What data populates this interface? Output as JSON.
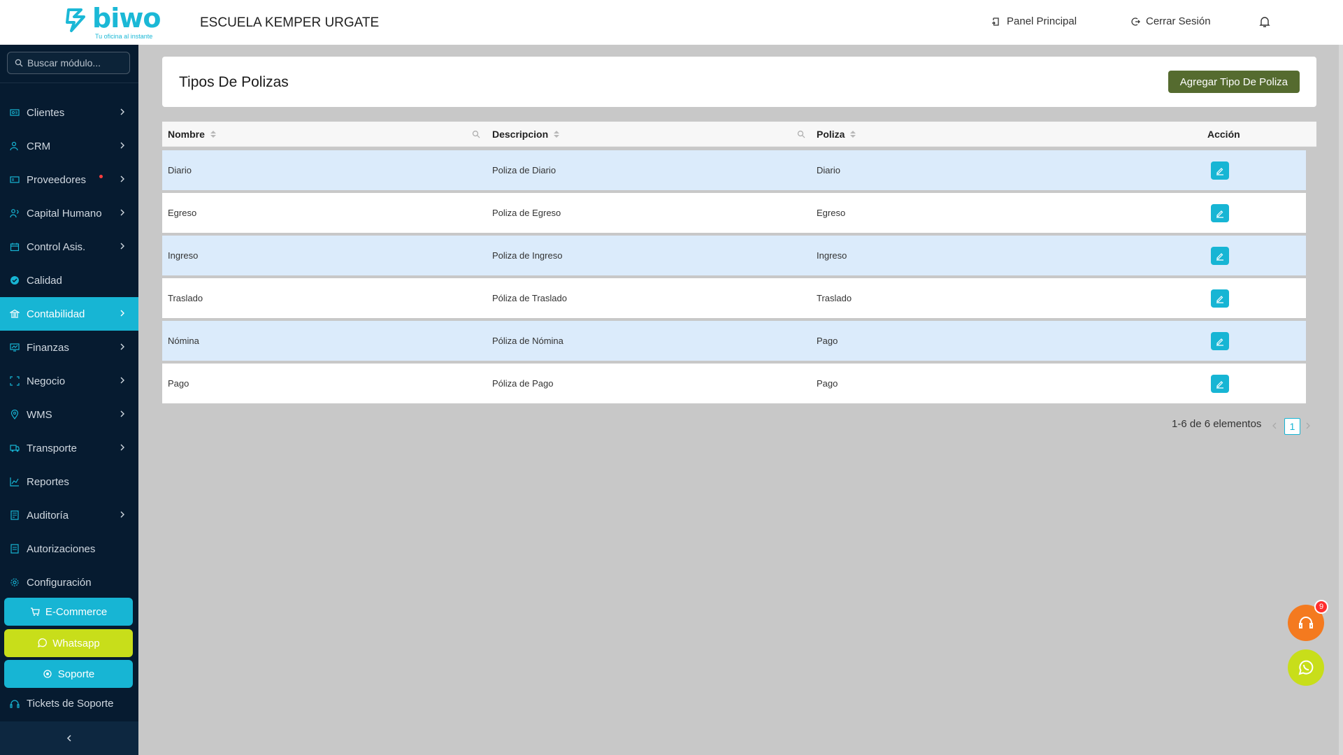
{
  "header": {
    "logo_text": "biwo",
    "logo_tagline": "Tu oficina al instante",
    "school": "ESCUELA KEMPER URGATE",
    "panel_link": "Panel Principal",
    "logout_link": "Cerrar Sesión"
  },
  "sidebar": {
    "search_placeholder": "Buscar módulo...",
    "items": [
      {
        "label": "Clientes",
        "icon": "id-card-icon"
      },
      {
        "label": "CRM",
        "icon": "users-icon"
      },
      {
        "label": "Proveedores",
        "icon": "vendor-icon"
      },
      {
        "label": "Capital Humano",
        "icon": "people-icon"
      },
      {
        "label": "Control Asis.",
        "icon": "calendar-icon"
      },
      {
        "label": "Calidad",
        "icon": "check-circle-icon"
      },
      {
        "label": "Contabilidad",
        "icon": "bank-icon"
      },
      {
        "label": "Finanzas",
        "icon": "finance-icon"
      },
      {
        "label": "Negocio",
        "icon": "expand-icon"
      },
      {
        "label": "WMS",
        "icon": "location-icon"
      },
      {
        "label": "Transporte",
        "icon": "truck-icon"
      },
      {
        "label": "Reportes",
        "icon": "chart-icon"
      },
      {
        "label": "Auditoría",
        "icon": "audit-icon"
      },
      {
        "label": "Autorizaciones",
        "icon": "document-icon"
      },
      {
        "label": "Configuración",
        "icon": "gear-icon"
      }
    ],
    "ecommerce": "E-Commerce",
    "whatsapp": "Whatsapp",
    "soporte": "Soporte",
    "tickets": "Tickets de Soporte"
  },
  "main": {
    "title": "Tipos De Polizas",
    "add_button": "Agregar Tipo De Poliza",
    "columns": [
      "Nombre",
      "Descripcion",
      "Poliza",
      "Acción"
    ],
    "rows": [
      {
        "nombre": "Diario",
        "descripcion": "Poliza de Diario",
        "poliza": "Diario"
      },
      {
        "nombre": "Egreso",
        "descripcion": "Poliza de Egreso",
        "poliza": "Egreso"
      },
      {
        "nombre": "Ingreso",
        "descripcion": "Poliza de Ingreso",
        "poliza": "Ingreso"
      },
      {
        "nombre": "Traslado",
        "descripcion": "Póliza de Traslado",
        "poliza": "Traslado"
      },
      {
        "nombre": "Nómina",
        "descripcion": "Póliza de Nómina",
        "poliza": "Pago"
      },
      {
        "nombre": "Pago",
        "descripcion": "Póliza de Pago",
        "poliza": "Pago"
      }
    ],
    "pagination": {
      "summary": "1-6 de 6 elementos",
      "current": "1"
    }
  },
  "support_badge": "9",
  "colors": {
    "accent": "#17b5d4",
    "sidebar": "#061b30",
    "add_button": "#556b2f",
    "whatsapp": "#c8de1a",
    "support_fab": "#f47a1f"
  }
}
